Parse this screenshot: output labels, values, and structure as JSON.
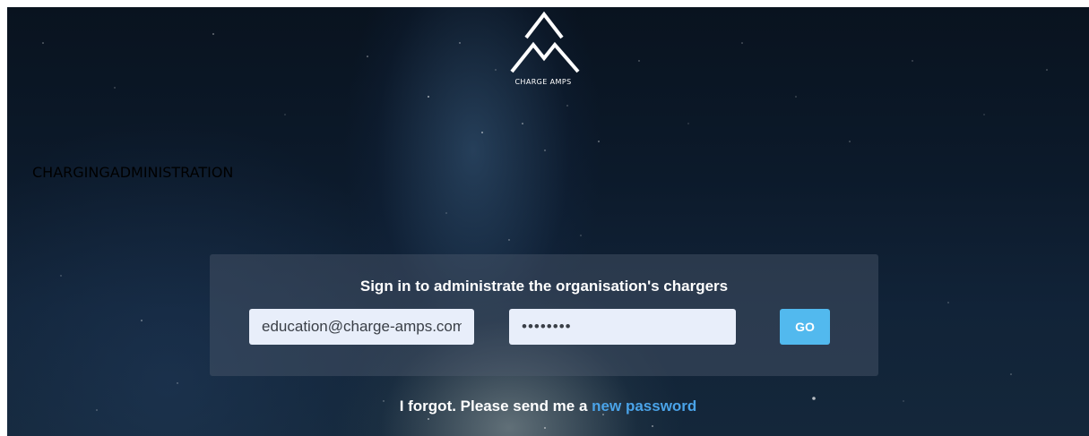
{
  "brand": {
    "logo_icon": "charge-amps-logo-icon",
    "logo_text": "CHARGE AMPS"
  },
  "headline": {
    "light": "CHARGING",
    "bold": "ADMINISTRATION"
  },
  "login": {
    "title": "Sign in to administrate the organisation's chargers",
    "email_value": "education@charge-amps.com",
    "password_value": "••••••••",
    "go_label": "GO"
  },
  "forgot": {
    "text": "I forgot. Please send me a ",
    "link": "new password"
  },
  "colors": {
    "accent": "#52b9ee",
    "link": "#4aa3e8",
    "input_bg": "#e8eefa"
  }
}
